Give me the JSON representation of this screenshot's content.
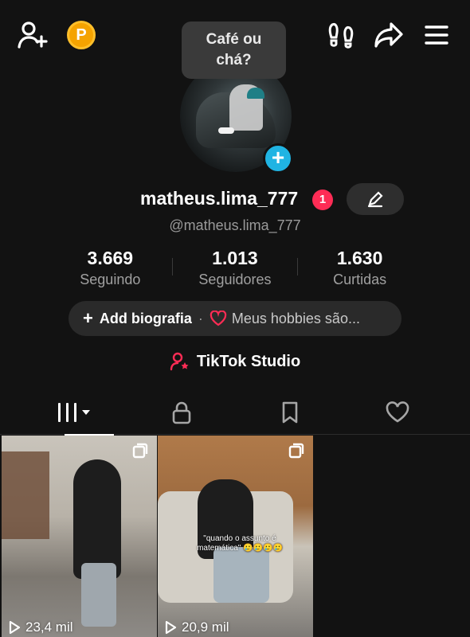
{
  "topbar": {
    "coin_label": "P",
    "icons": [
      "add-user-icon",
      "coin-icon",
      "footprints-icon",
      "share-icon",
      "menu-icon"
    ]
  },
  "tooltip": {
    "line1": "Café ou",
    "line2": "chá?"
  },
  "profile": {
    "username": "matheus.lima_777",
    "notification_count": "1",
    "handle": "@matheus.lima_777",
    "add_badge": "+"
  },
  "stats": [
    {
      "value": "3.669",
      "label": "Seguindo"
    },
    {
      "value": "1.013",
      "label": "Seguidores"
    },
    {
      "value": "1.630",
      "label": "Curtidas"
    }
  ],
  "bio": {
    "add_label": "Add biografia",
    "separator": "·",
    "hobby_label": "Meus hobbies são..."
  },
  "studio": {
    "label": "TikTok Studio"
  },
  "tabs": [
    "videos-grid",
    "private",
    "saved",
    "liked"
  ],
  "videos": [
    {
      "views": "23,4 mil",
      "caption": ""
    },
    {
      "views": "20,9 mil",
      "caption": "\"quando o assunto é matemática\" 🥲🥲🥲🥲"
    }
  ],
  "colors": {
    "background": "#121212",
    "accent_red": "#fe2c55",
    "accent_blue": "#20b4e3",
    "coin": "#f5a300"
  }
}
